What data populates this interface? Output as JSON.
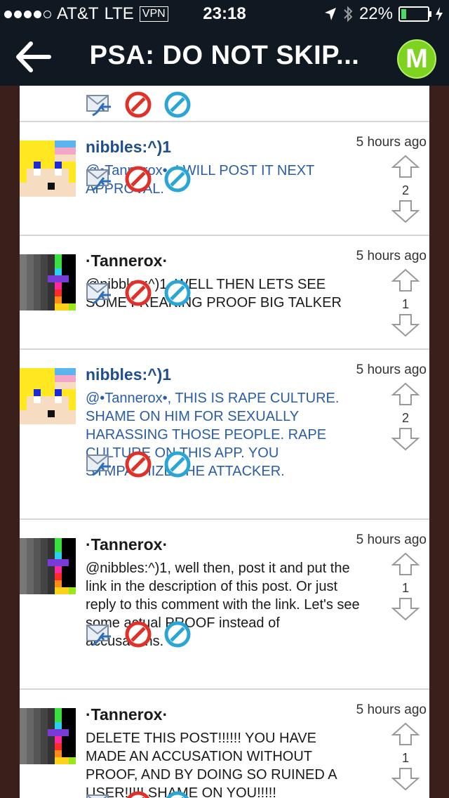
{
  "status_bar": {
    "carrier": "AT&T",
    "network": "LTE",
    "vpn": "VPN",
    "time": "23:18",
    "battery_percent": "22%",
    "battery_level": 0.22,
    "signal_bars": 4
  },
  "nav": {
    "title": "PSA: DO NOT SKIP...",
    "logo_letter": "M",
    "back_icon": "back-arrow-icon"
  },
  "comments": [
    {
      "username": "nibbles:^)1",
      "time": "5 hours ago",
      "text": "@•Tannerox•, I WILL POST IT NEXT APPROVAL.",
      "votes": "2",
      "style": "blue",
      "avatar": "nibbles"
    },
    {
      "username": "·Tannerox·",
      "time": "5 hours ago",
      "text": "@nibbles:^)1, WELL THEN LETS SEE SOME FREAKING PROOF BIG TALKER",
      "votes": "1",
      "style": "black",
      "avatar": "tannerox"
    },
    {
      "username": "nibbles:^)1",
      "time": "5 hours ago",
      "text": "@•Tannerox•, THIS IS RAPE CULTURE. SHAME ON HIM FOR SEXUALLY HARASSING THOSE PEOPLE. RAPE CULTURE ON THIS APP. YOU SYMPATHIZE THE ATTACKER.",
      "votes": "2",
      "style": "blue",
      "avatar": "nibbles"
    },
    {
      "username": "·Tannerox·",
      "time": "5 hours ago",
      "text": "@nibbles:^)1, well then, post it and put the link in the description of this post. Or just reply to this comment with the link. Let's see some actual PROOF instead of accusations.",
      "votes": "1",
      "style": "black",
      "avatar": "tannerox"
    },
    {
      "username": "·Tannerox·",
      "time": "5 hours ago",
      "text": "DELETE THIS POST!!!!!! YOU HAVE MADE AN ACCUSATION WITHOUT PROOF, AND BY DOING SO RUINED A USER!!!!! SHAME ON YOU!!!!!",
      "votes": "1",
      "style": "black",
      "avatar": "tannerox"
    }
  ],
  "icons": {
    "reply": "reply-envelope-icon",
    "report": "report-icon",
    "block": "block-icon",
    "upvote": "upvote-arrow-icon",
    "downvote": "downvote-arrow-icon"
  }
}
